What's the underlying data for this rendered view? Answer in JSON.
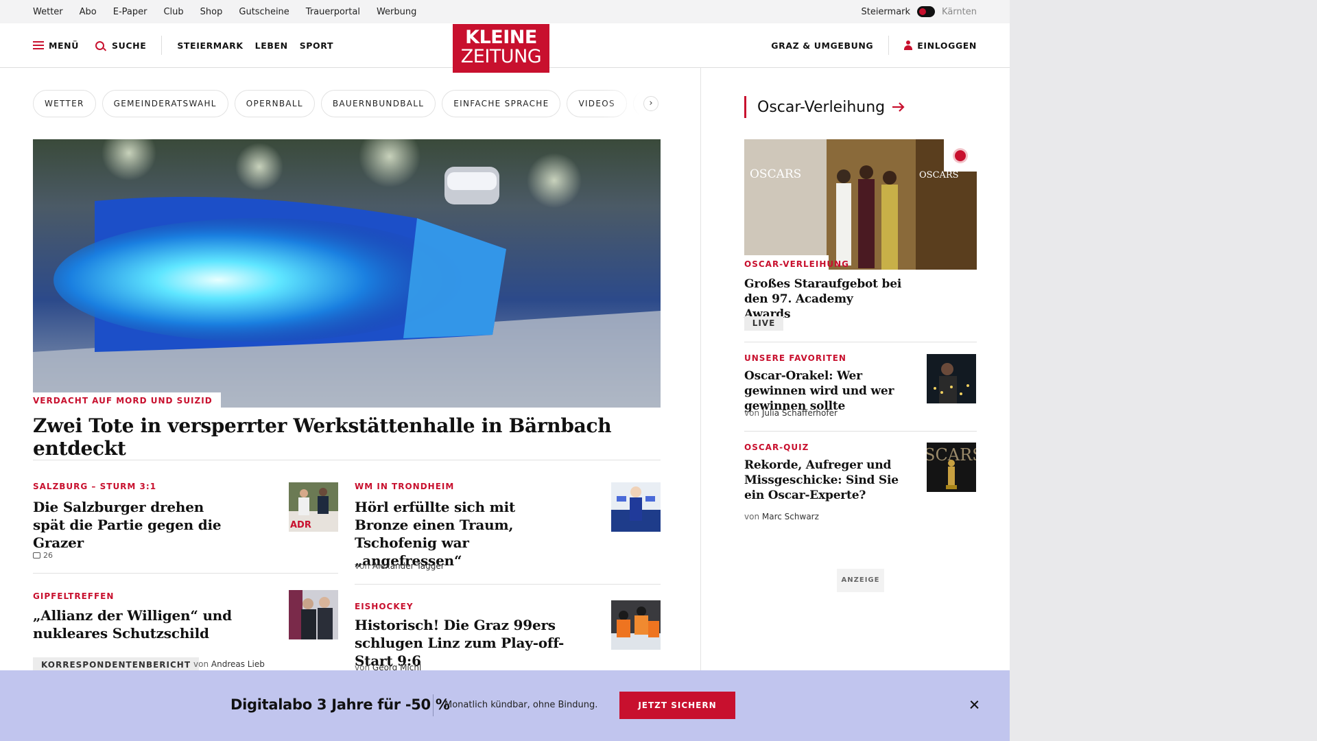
{
  "util_links": [
    "Wetter",
    "Abo",
    "E-Paper",
    "Club",
    "Shop",
    "Gutscheine",
    "Trauerportal",
    "Werbung"
  ],
  "region": {
    "active": "Steiermark",
    "other": "Kärnten"
  },
  "header": {
    "menu_label": "MENÜ",
    "search_label": "SUCHE",
    "nav": [
      "STEIERMARK",
      "LEBEN",
      "SPORT"
    ],
    "logo_line1": "KLEINE",
    "logo_line2": "ZEITUNG",
    "local_label": "GRAZ & UMGEBUNG",
    "login_label": "EINLOGGEN"
  },
  "chips": [
    "WETTER",
    "GEMEINDERATSWAHL",
    "OPERNBALL",
    "BAUERNBUNDBALL",
    "EINFACHE SPRACHE",
    "VIDEOS",
    "K"
  ],
  "hero": {
    "kicker": "VERDACHT AUF MORD UND SUIZID",
    "title": "Zwei Tote in versperrter Werkstättenhalle in Bärnbach entdeckt"
  },
  "articles": [
    {
      "kicker": "SALZBURG – STURM 3:1",
      "title": "Die Salzburger drehen spät die Partie gegen die Grazer",
      "comments": "26"
    },
    {
      "kicker": "WM IN TRONDHEIM",
      "title": "Hörl erfüllte sich mit Bronze einen Traum, Tschofenig war „angefressen“",
      "by": "von",
      "author": "Alexander Tagger"
    },
    {
      "kicker": "GIPFELTREFFEN",
      "title": "„Allianz der Willigen“ und nukleares Schutzschild",
      "tag": "KORRESPONDENTENBERICHT",
      "by": "von",
      "author": "Andreas Lieb"
    },
    {
      "kicker": "EISHOCKEY",
      "title": "Historisch! Die Graz 99ers schlugen Linz zum Play-off-Start 9:6",
      "by": "von",
      "author": "Georg Michl"
    }
  ],
  "sidebar": {
    "heading": "Oscar-Verleihung",
    "image_text_left": "OSCARS",
    "image_text_right": "OSCARS",
    "main": {
      "kicker": "OSCAR-VERLEIHUNG",
      "title": "Großes Staraufgebot bei den 97. Academy Awards",
      "badge": "LIVE"
    },
    "items": [
      {
        "kicker": "UNSERE FAVORITEN",
        "title": "Oscar-Orakel: Wer gewinnen wird und wer gewinnen sollte",
        "by": "von",
        "author": "Julia Schafferhofer"
      },
      {
        "kicker": "OSCAR-QUIZ",
        "title": "Rekorde, Aufreger und Missgeschicke: Sind Sie ein Oscar-Experte?",
        "by": "von",
        "author": "Marc Schwarz",
        "thumb_text": "SCARS"
      }
    ],
    "ad_label": "ANZEIGE"
  },
  "promo": {
    "title": "Digitalabo 3 Jahre für -50 %",
    "subtitle": "Monatlich kündbar, ohne Bindung.",
    "button": "JETZT SICHERN"
  },
  "colors": {
    "brand_red": "#c8102e",
    "promo_bg": "#c1c5ee"
  }
}
